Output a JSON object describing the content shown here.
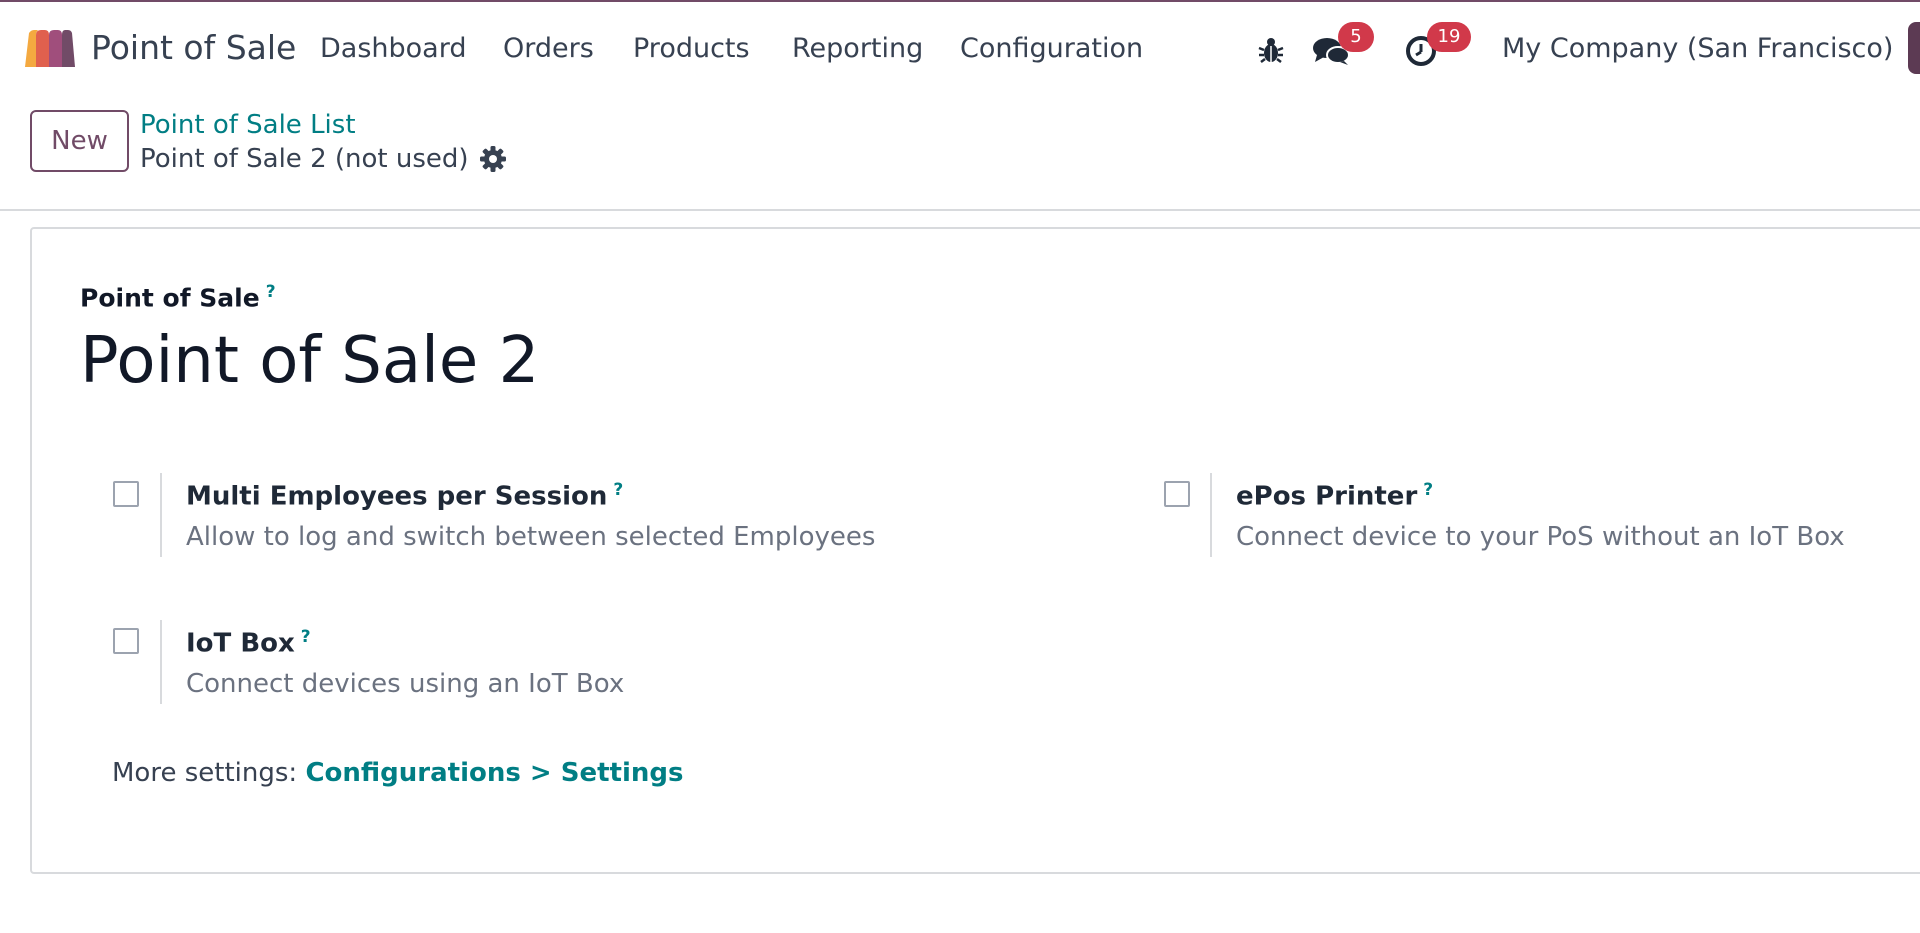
{
  "app": {
    "name": "Point of Sale"
  },
  "navbar": {
    "menu": [
      "Dashboard",
      "Orders",
      "Products",
      "Reporting",
      "Configuration"
    ],
    "messages_count": "5",
    "activities_count": "19",
    "company": "My Company (San Francisco)"
  },
  "control": {
    "new_label": "New",
    "breadcrumb_parent": "Point of Sale List",
    "breadcrumb_current": "Point of Sale 2 (not used)"
  },
  "form": {
    "field_label": "Point of Sale",
    "help_mark": "?",
    "name": "Point of Sale 2",
    "settings": [
      {
        "title": "Multi Employees per Session",
        "description": "Allow to log and switch between selected Employees",
        "checked": false
      },
      {
        "title": "ePos Printer",
        "description": "Connect device to your PoS without an IoT Box",
        "checked": false
      },
      {
        "title": "IoT Box",
        "description": "Connect devices using an IoT Box",
        "checked": false
      }
    ],
    "more_settings_label": "More settings:",
    "more_settings_link": "Configurations > Settings"
  },
  "colors": {
    "brand": "#714B67",
    "link": "#017E84",
    "badge": "#D1394A"
  },
  "icons": [
    "bug-icon",
    "chat-icon",
    "clock-icon",
    "gear-icon"
  ]
}
